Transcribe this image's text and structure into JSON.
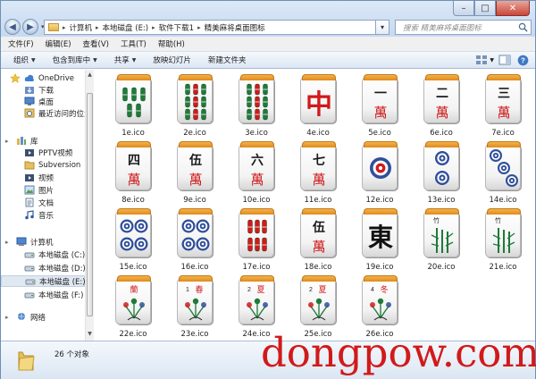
{
  "window": {
    "controls": {
      "minimize": "–",
      "maximize": "□",
      "close": "✕"
    }
  },
  "address": {
    "segments": [
      "计算机",
      "本地磁盘 (E:)",
      "软件下载1",
      "精美麻将桌面图标"
    ],
    "search_placeholder": "搜索 精美麻将桌面图标"
  },
  "menu": [
    "文件(F)",
    "编辑(E)",
    "查看(V)",
    "工具(T)",
    "帮助(H)"
  ],
  "toolbar": {
    "items": [
      "组织",
      "包含到库中",
      "共享",
      "放映幻灯片",
      "新建文件夹"
    ],
    "dropdown_flags": [
      true,
      true,
      true,
      false,
      false
    ]
  },
  "sidebar": {
    "favorites": [
      "OneDrive",
      "下载",
      "桌面",
      "最近访问的位置"
    ],
    "libraries_header": "库",
    "libraries": [
      "PPTV视频",
      "Subversion",
      "视频",
      "图片",
      "文档",
      "音乐"
    ],
    "computer_header": "计算机",
    "drives": [
      "本地磁盘 (C:)",
      "本地磁盘 (D:)",
      "本地磁盘 (E:)",
      "本地磁盘 (F:)"
    ],
    "selected_drive": "本地磁盘 (E:)",
    "network": "网络"
  },
  "files": [
    {
      "name": "1e.ico",
      "tile": "bamboo-5"
    },
    {
      "name": "2e.ico",
      "tile": "bamboo-9"
    },
    {
      "name": "3e.ico",
      "tile": "bamboo-9"
    },
    {
      "name": "4e.ico",
      "tile": "red-dragon",
      "glyph": "中"
    },
    {
      "name": "5e.ico",
      "tile": "wan",
      "glyph": "一"
    },
    {
      "name": "6e.ico",
      "tile": "wan",
      "glyph": "二"
    },
    {
      "name": "7e.ico",
      "tile": "wan",
      "glyph": "三"
    },
    {
      "name": "8e.ico",
      "tile": "wan",
      "glyph": "四"
    },
    {
      "name": "9e.ico",
      "tile": "wan",
      "glyph": "伍"
    },
    {
      "name": "10e.ico",
      "tile": "wan",
      "glyph": "六"
    },
    {
      "name": "11e.ico",
      "tile": "wan",
      "glyph": "七"
    },
    {
      "name": "12e.ico",
      "tile": "circle-1"
    },
    {
      "name": "13e.ico",
      "tile": "circle-2"
    },
    {
      "name": "14e.ico",
      "tile": "circle-3"
    },
    {
      "name": "15e.ico",
      "tile": "circle-4"
    },
    {
      "name": "16e.ico",
      "tile": "circle-4"
    },
    {
      "name": "17e.ico",
      "tile": "bamboo-6"
    },
    {
      "name": "18e.ico",
      "tile": "wan",
      "glyph": "伍"
    },
    {
      "name": "19e.ico",
      "tile": "east-wind",
      "glyph": "東"
    },
    {
      "name": "20e.ico",
      "tile": "flower-bamboo"
    },
    {
      "name": "21e.ico",
      "tile": "flower-bamboo"
    },
    {
      "name": "22e.ico",
      "tile": "flower-orchid",
      "glyph": "蘭"
    },
    {
      "name": "23e.ico",
      "tile": "flower-spring",
      "glyph": "春"
    },
    {
      "name": "24e.ico",
      "tile": "flower-summer",
      "glyph": "夏"
    },
    {
      "name": "25e.ico",
      "tile": "flower-summer",
      "glyph": "夏"
    },
    {
      "name": "26e.ico",
      "tile": "flower-winter",
      "glyph": "冬"
    }
  ],
  "status": {
    "count": "26 个对象"
  },
  "watermark": "dongpow.com",
  "colors": {
    "accent": "#d11a1a",
    "bamboo": "#1f7a3a",
    "circle": "#2f4f9a",
    "tile_top": "#e8961f"
  }
}
